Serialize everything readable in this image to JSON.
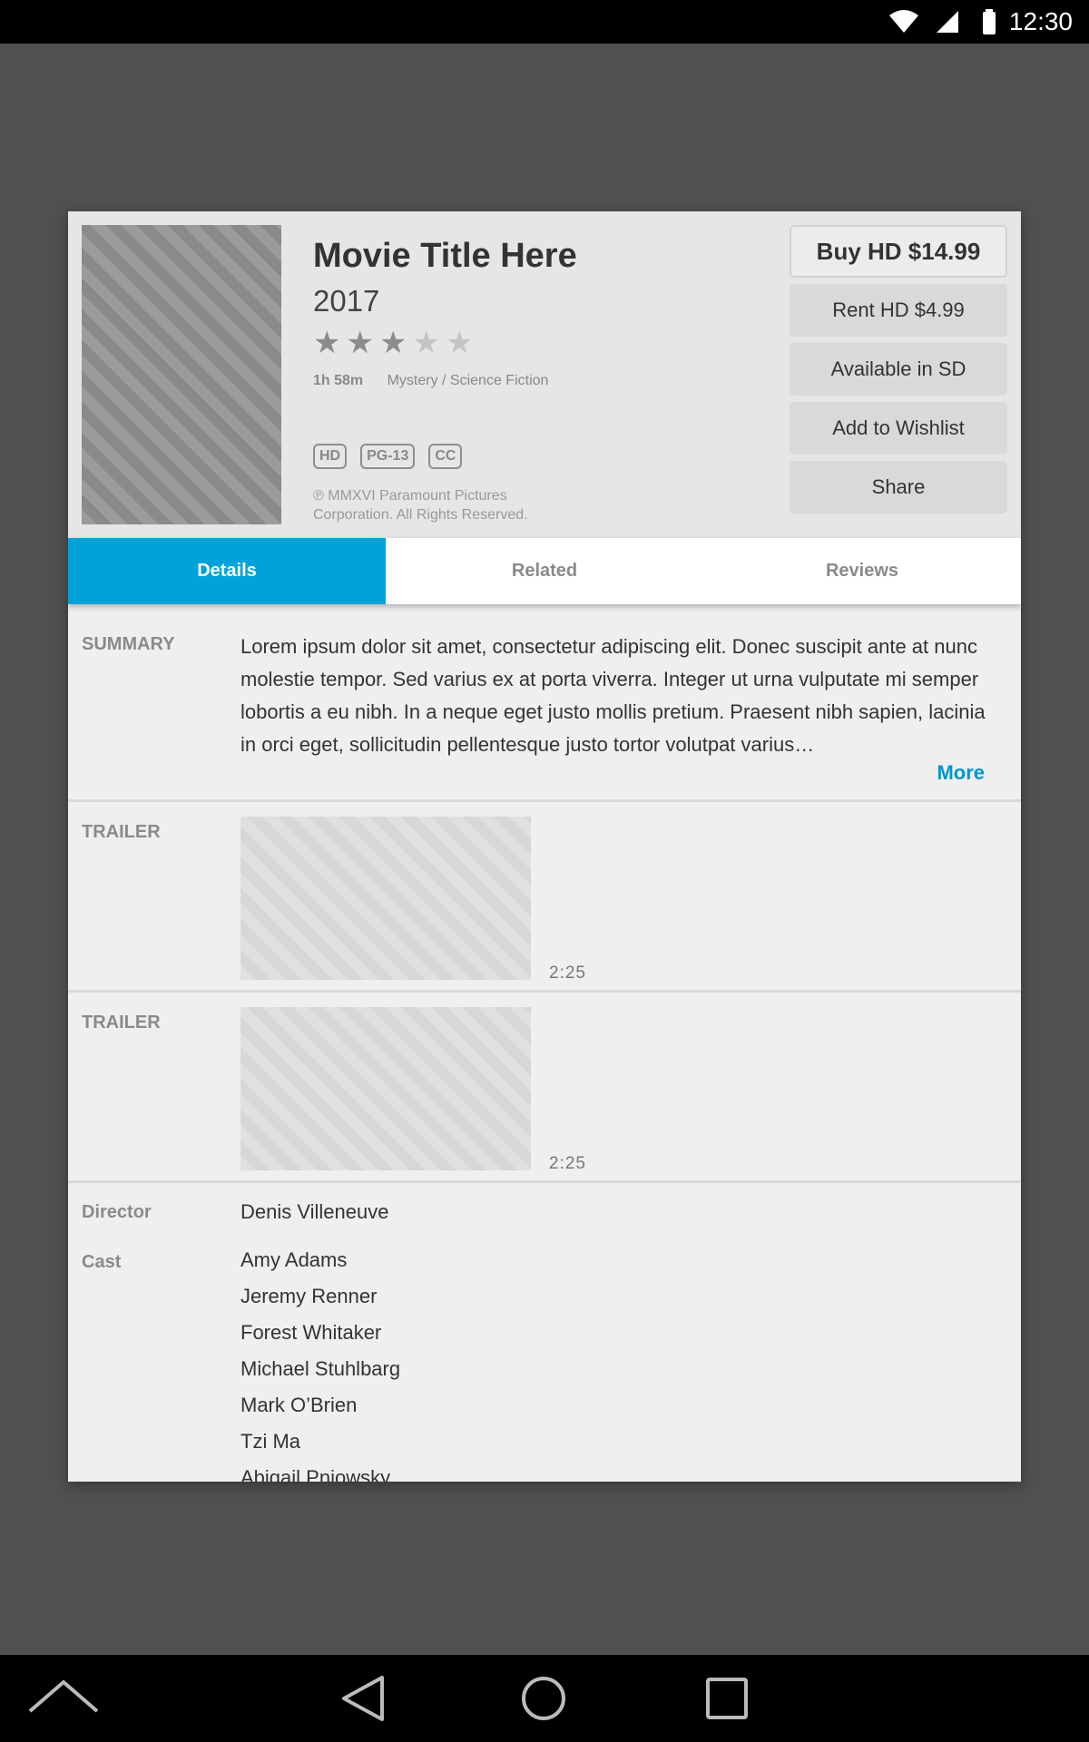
{
  "status": {
    "time": "12:30"
  },
  "movie": {
    "title": "Movie Title Here",
    "year": "2017",
    "rating": 3,
    "rating_max": 5,
    "runtime": "1h 58m",
    "genres": "Mystery / Science Fiction",
    "badges": [
      "HD",
      "PG-13",
      "CC"
    ],
    "copyright": "℗ MMXVI Paramount Pictures Corporation. All Rights Reserved."
  },
  "actions": {
    "buy": "Buy HD $14.99",
    "rent": "Rent HD $4.99",
    "sd": "Available in SD",
    "wishlist": "Add to Wishlist",
    "share": "Share"
  },
  "tabs": [
    {
      "label": "Details",
      "active": true
    },
    {
      "label": "Related",
      "active": false
    },
    {
      "label": "Reviews",
      "active": false
    }
  ],
  "summary": {
    "label": "SUMMARY",
    "text": "Lorem ipsum dolor sit amet, consectetur adipiscing elit. Donec suscipit ante at nunc molestie tempor. Sed varius ex at porta viverra. Integer ut urna vulputate mi semper lobortis a eu nibh. In a neque eget justo mollis pretium. Praesent nibh sapien, lacinia in orci eget, sollicitudin pellentesque justo tortor volutpat varius…",
    "more": "More"
  },
  "trailers": [
    {
      "label": "TRAILER",
      "duration": "2:25"
    },
    {
      "label": "TRAILER",
      "duration": "2:25"
    }
  ],
  "credits": {
    "director_label": "Director",
    "director": "Denis Villeneuve",
    "cast_label": "Cast",
    "cast": [
      "Amy Adams",
      "Jeremy Renner",
      "Forest Whitaker",
      "Michael Stuhlbarg",
      "Mark O’Brien",
      "Tzi Ma",
      "Abigail Pniowsky"
    ]
  },
  "colors": {
    "accent": "#00a3d9",
    "link": "#0096cc",
    "backdrop": "#505050"
  }
}
